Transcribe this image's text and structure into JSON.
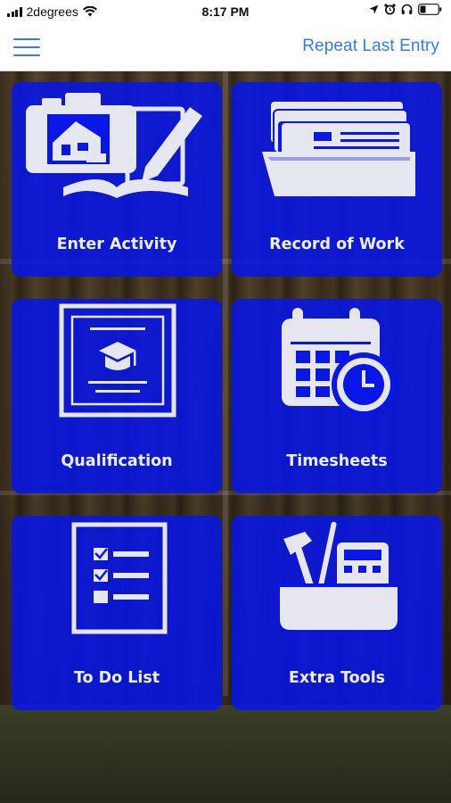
{
  "status_bar": {
    "carrier": "2degrees",
    "time": "8:17 PM"
  },
  "nav": {
    "repeat_label": "Repeat Last Entry"
  },
  "tiles": [
    {
      "label": "Enter Activity",
      "icon": "activity-camera-notebook-icon"
    },
    {
      "label": "Record of Work",
      "icon": "file-folder-icon"
    },
    {
      "label": "Qualification",
      "icon": "certificate-icon"
    },
    {
      "label": "Timesheets",
      "icon": "calendar-clock-icon"
    },
    {
      "label": "To Do List",
      "icon": "checklist-icon"
    },
    {
      "label": "Extra Tools",
      "icon": "toolbox-icon"
    }
  ],
  "colors": {
    "accent": "#2f7cf6",
    "tile": "#0816e6",
    "icon": "#e6e6ee"
  }
}
